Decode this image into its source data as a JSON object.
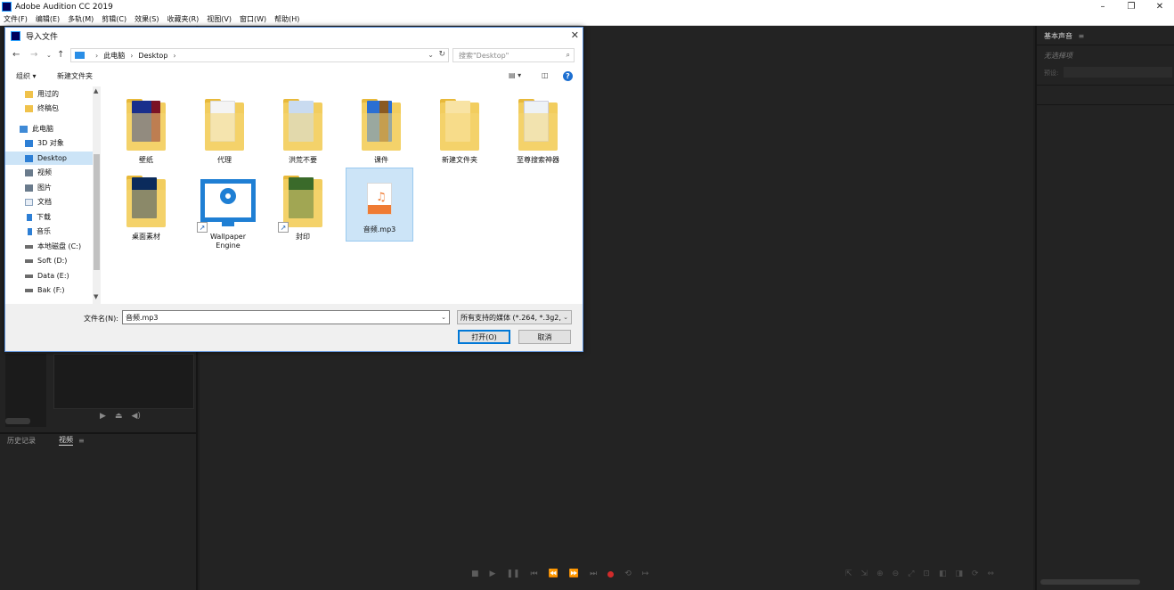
{
  "app": {
    "title": "Adobe Audition CC 2019",
    "window_buttons": [
      "–",
      "❐",
      "✕"
    ]
  },
  "menu": [
    "文件(F)",
    "编辑(E)",
    "多轨(M)",
    "剪辑(C)",
    "效果(S)",
    "收藏夹(R)",
    "视图(V)",
    "窗口(W)",
    "帮助(H)"
  ],
  "right_panel": {
    "title": "基本声音",
    "menu_icon": "≡",
    "no_selection": "无选择项",
    "preset_label": "预设:"
  },
  "left_panel": {
    "tabs": [
      "历史记录",
      "视频"
    ],
    "tab_menu_icon": "≡"
  },
  "dialog": {
    "title": "导入文件",
    "address": {
      "segments": [
        "此电脑",
        "Desktop"
      ]
    },
    "search_placeholder": "搜索\"Desktop\"",
    "toolbar": {
      "organize": "组织 ▾",
      "new_folder": "新建文件夹"
    },
    "nav_items": [
      {
        "label": "用过的",
        "icon": "folder-icon"
      },
      {
        "label": "终稿包",
        "icon": "folder-icon"
      },
      {
        "label": "此电脑",
        "icon": "computer-icon"
      },
      {
        "label": "3D 对象",
        "icon": "3d-objects-icon"
      },
      {
        "label": "Desktop",
        "icon": "desktop-icon"
      },
      {
        "label": "视频",
        "icon": "video-icon"
      },
      {
        "label": "图片",
        "icon": "pictures-icon"
      },
      {
        "label": "文档",
        "icon": "documents-icon"
      },
      {
        "label": "下载",
        "icon": "download-icon"
      },
      {
        "label": "音乐",
        "icon": "music-icon"
      },
      {
        "label": "本地磁盘 (C:)",
        "icon": "drive-icon"
      },
      {
        "label": "Soft (D:)",
        "icon": "drive-icon"
      },
      {
        "label": "Data (E:)",
        "icon": "drive-icon"
      },
      {
        "label": "Bak (F:)",
        "icon": "drive-icon"
      }
    ],
    "files": [
      {
        "label": "壁纸",
        "icon": "folder-icon"
      },
      {
        "label": "代理",
        "icon": "folder-icon"
      },
      {
        "label": "洪荒不要",
        "icon": "folder-icon"
      },
      {
        "label": "课件",
        "icon": "folder-icon"
      },
      {
        "label": "新建文件夹",
        "icon": "folder-icon"
      },
      {
        "label": "至尊搜索神器",
        "icon": "folder-icon"
      },
      {
        "label": "桌面素材",
        "icon": "folder-icon"
      },
      {
        "label": "Wallpaper Engine",
        "icon": "wallpaper-engine-icon"
      },
      {
        "label": "封印",
        "icon": "folder-shortcut-icon"
      },
      {
        "label": "音频.mp3",
        "icon": "audio-file-icon"
      }
    ],
    "filename_label": "文件名(N):",
    "filename_value": "音频.mp3",
    "filetype_value": "所有支持的媒体 (*.264, *.3g2,",
    "open_button": "打开(O)",
    "cancel_button": "取消"
  },
  "colors": {
    "workspace_bg": "#232323",
    "dialog_border": "#5a8fd8",
    "selection": "#cce4f7",
    "accent_blue": "#0078d7",
    "record_red": "#d12b2b",
    "audio_orange": "#ef7b33"
  }
}
